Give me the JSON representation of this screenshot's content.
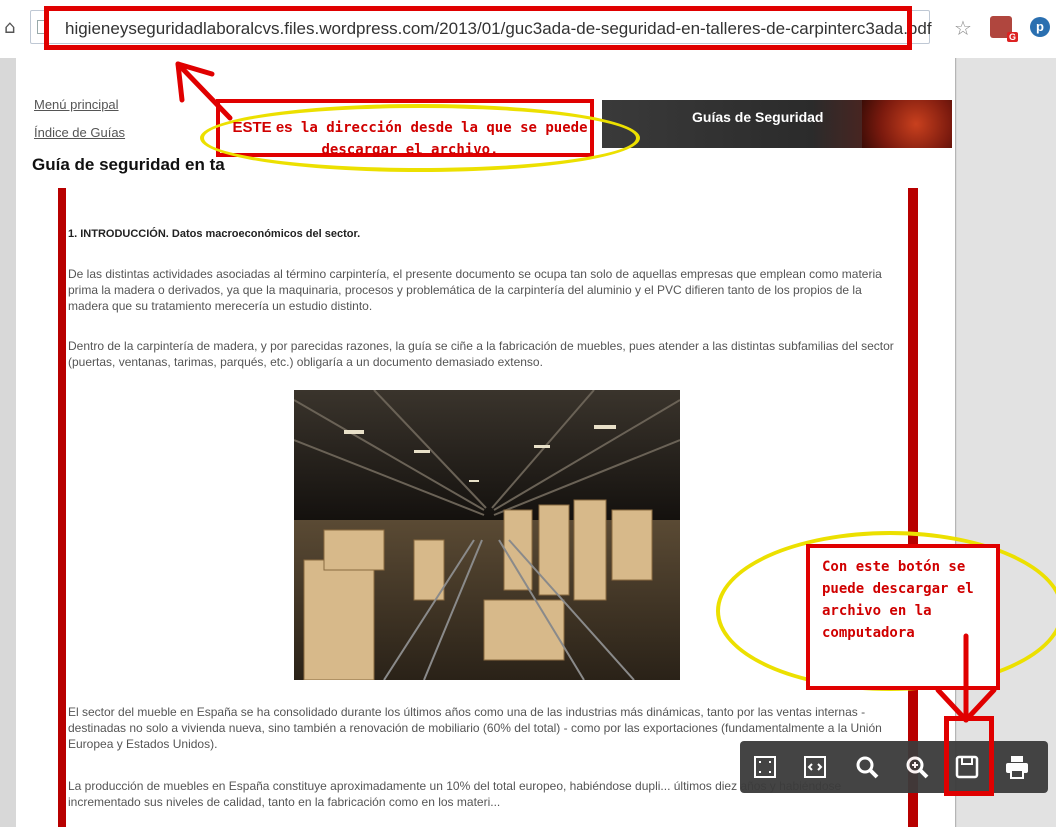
{
  "browser": {
    "url": "higieneyseguridadlaboralcvs.files.wordpress.com/2013/01/guc3ada-de-seguridad-en-talleres-de-carpinterc3ada.pdf",
    "home_icon": "home-icon",
    "star_icon": "bookmark-star-icon",
    "extension_badge": "G",
    "extension_icon_2": "p"
  },
  "document": {
    "nav_main": "Menú principal",
    "nav_index": "Índice de Guías",
    "title": "Guía de seguridad en ta",
    "banner_label": "Guías de Seguridad",
    "heading": "1.   INTRODUCCIÓN. Datos macroeconómicos del sector.",
    "paragraphs": [
      "De las distintas actividades asociadas al término carpintería, el presente documento se ocupa tan solo de aquellas empresas que emplean como materia prima la madera o derivados, ya que la maquinaria, procesos y problemática de la carpintería del aluminio y el PVC difieren tanto de los propios de la madera que su tratamiento merecería un estudio distinto.",
      "Dentro de la carpintería de madera, y por parecidas razones, la guía se ciñe a la fabricación de muebles, pues atender a las distintas subfamilias del sector (puertas, ventanas, tarimas, parqués, etc.) obligaría a un documento demasiado extenso.",
      "El sector del mueble en España se ha consolidado durante los últimos años como una de las industrias más dinámicas, tanto por las ventas internas - destinadas no solo a vivienda nueva, sino también a renovación de mobiliario (60% del total) - como por las exportaciones (fundamentalmente a la Unión Europea y Estados Unidos).",
      "La producción de muebles en España constituye aproximadamente un 10% del total europeo, habiéndose dupli... últimos diez años y habiéndose incrementado sus niveles de calidad, tanto en la fabricación como en los materi..."
    ]
  },
  "annotations": {
    "top_lead": "ESTE es",
    "top_text": "la dirección desde la que se puede descargar el archivo.",
    "right_text": "Con este botón se puede descargar el archivo en la computadora",
    "color_red": "#e00000",
    "color_yellow": "#ece000"
  },
  "pdf_toolbar": {
    "buttons": [
      "fit-page-icon",
      "fit-width-icon",
      "zoom-out-icon",
      "zoom-in-icon",
      "save-icon",
      "print-icon"
    ]
  }
}
